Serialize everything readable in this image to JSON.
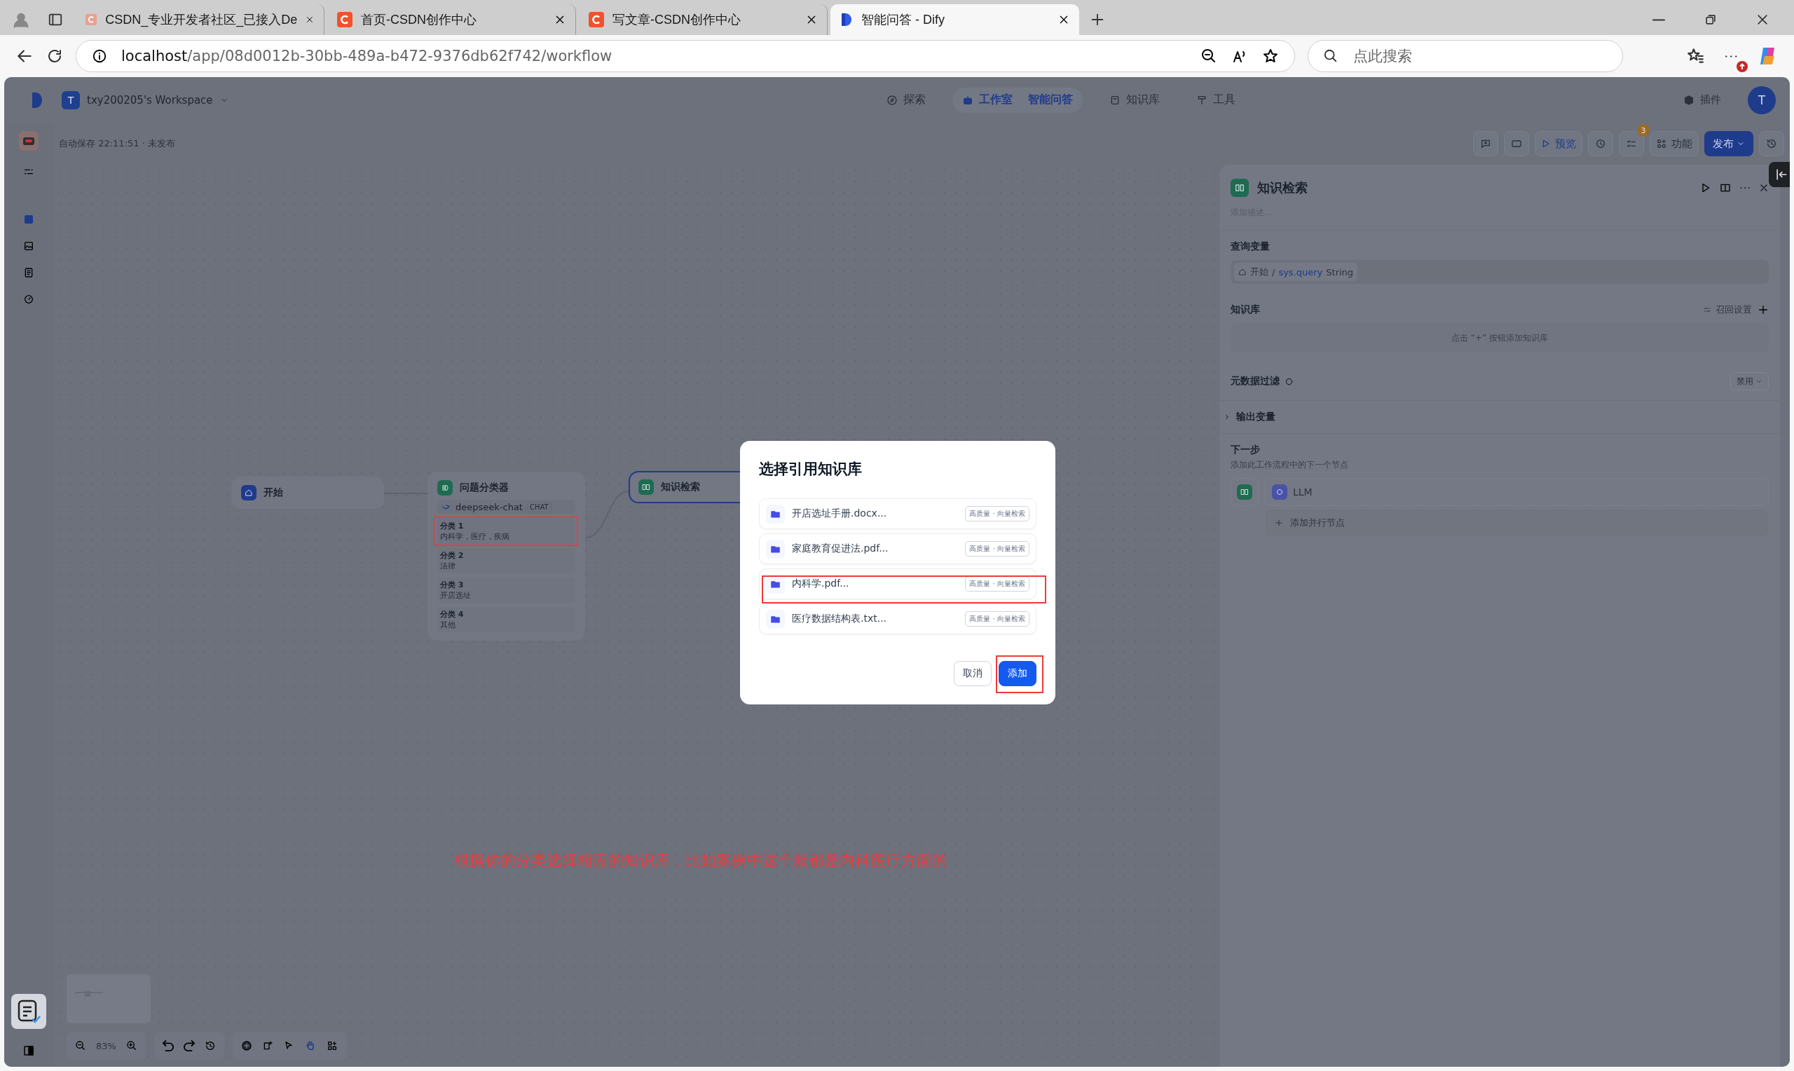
{
  "browser": {
    "tabs": [
      {
        "title": "CSDN_专业开发者社区_已接入De",
        "kind": "csdn",
        "faded": true,
        "selected": false
      },
      {
        "title": "首页-CSDN创作中心",
        "kind": "csdn",
        "faded": false,
        "selected": false
      },
      {
        "title": "写文章-CSDN创作中心",
        "kind": "csdn",
        "faded": false,
        "selected": false
      },
      {
        "title": "智能问答 - Dify",
        "kind": "dify",
        "faded": false,
        "selected": true
      }
    ],
    "address": {
      "host": "localhost",
      "path": "/app/08d0012b-30bb-489a-b472-9376db62f742/workflow"
    },
    "search": {
      "placeholder": "点此搜索"
    }
  },
  "header": {
    "workspace": {
      "initial": "T",
      "name": "txy200205's Workspace"
    },
    "nav": [
      {
        "label": "探索",
        "kind": "explore",
        "selected": false
      },
      {
        "label": "工作室",
        "kind": "studio",
        "selected": true,
        "crumb": "智能问答"
      },
      {
        "label": "知识库",
        "kind": "datasets",
        "selected": false
      },
      {
        "label": "工具",
        "kind": "tools",
        "selected": false
      }
    ],
    "plugins": "插件",
    "avatar": "T"
  },
  "toolbar": {
    "status": "自动保存 22:11:51 · 未发布",
    "preview": "预览",
    "checklist_count": "3",
    "features": "功能",
    "publish": "发布"
  },
  "canvas": {
    "nodes": [
      {
        "kind": "start",
        "title": "开始",
        "selected": false
      },
      {
        "kind": "classifier",
        "title": "问题分类器",
        "selected": false,
        "model": "deepseek-chat",
        "model_tag": "CHAT",
        "classes": [
          {
            "label": "分类 1",
            "text": "内科学，医疗，疾病",
            "highlighted": true
          },
          {
            "label": "分类 2",
            "text": "法律",
            "highlighted": false
          },
          {
            "label": "分类 3",
            "text": "开店选址",
            "highlighted": false
          },
          {
            "label": "分类 4",
            "text": "其他",
            "highlighted": false
          }
        ]
      },
      {
        "kind": "knowledge",
        "title": "知识检索",
        "selected": true
      }
    ],
    "note": "根据你的分类选择相应的知识库，比如案例中这个就都是内科医疗方面的",
    "zoom": "83%"
  },
  "panel": {
    "title": "知识检索",
    "description_placeholder": "添加描述...",
    "query": {
      "label": "查询变量",
      "node": "开始",
      "separator": "/",
      "variable": "sys.query",
      "type": "String"
    },
    "knowledge": {
      "label": "知识库",
      "recall": "召回设置",
      "empty": "点击 “+” 按钮添加知识库"
    },
    "metadata": {
      "label": "元数据过滤",
      "value": "禁用"
    },
    "output": {
      "label": "输出变量",
      "expanded": false
    },
    "next": {
      "label": "下一步",
      "hint": "添加此工作流程中的下一个节点",
      "node": "LLM",
      "add_parallel": "添加并行节点"
    }
  },
  "dialog": {
    "title": "选择引用知识库",
    "items": [
      {
        "name": "开店选址手册.docx...",
        "tag": "高质量 · 向量检索",
        "highlighted": false
      },
      {
        "name": "家庭教育促进法.pdf...",
        "tag": "高质量 · 向量检索",
        "highlighted": false
      },
      {
        "name": "内科学.pdf...",
        "tag": "高质量 · 向量检索",
        "highlighted": true
      },
      {
        "name": "医疗数据结构表.txt...",
        "tag": "高质量 · 向量检索",
        "highlighted": false
      }
    ],
    "buttons": [
      {
        "label": "取消",
        "kind": "secondary",
        "highlighted": false
      },
      {
        "label": "添加",
        "kind": "primary",
        "highlighted": true
      }
    ]
  }
}
